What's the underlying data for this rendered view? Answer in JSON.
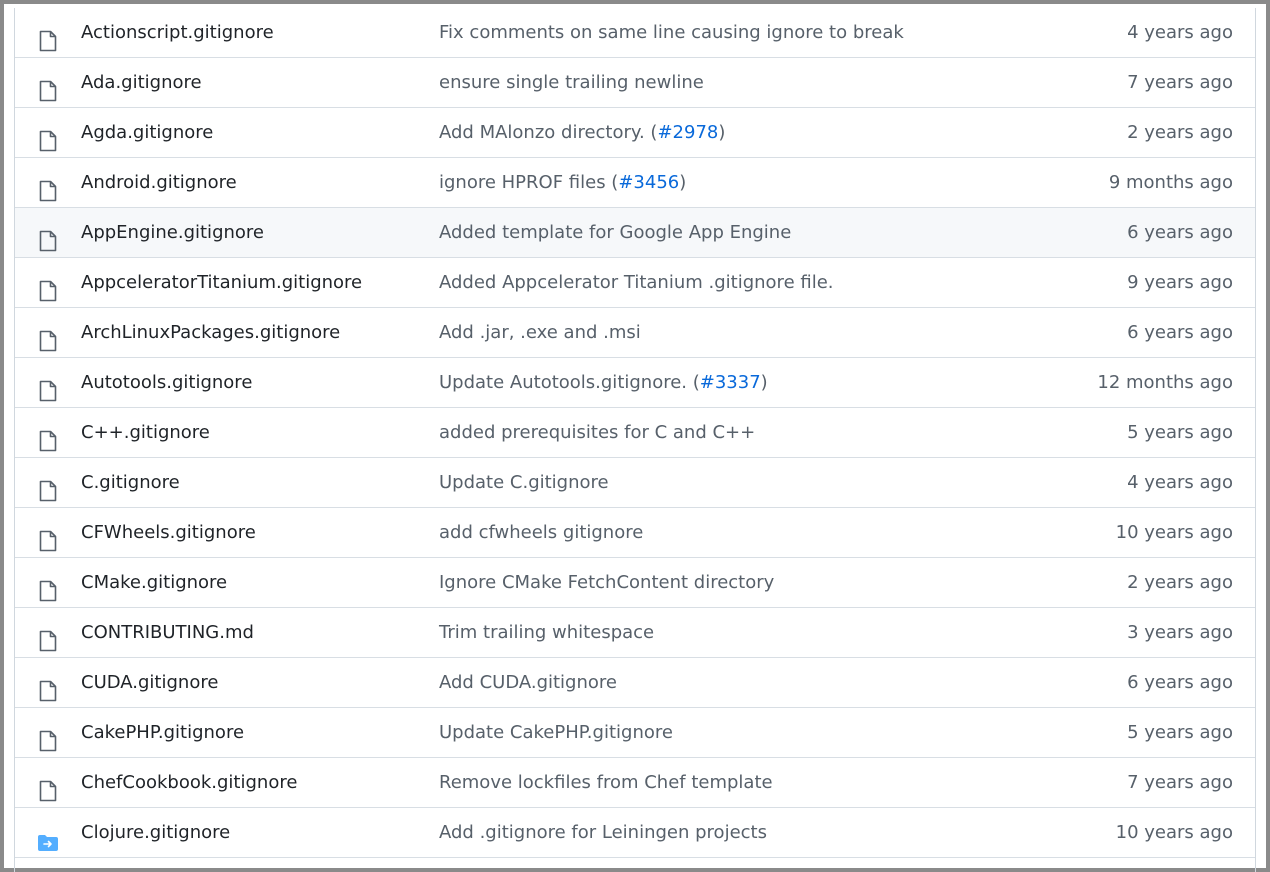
{
  "colors": {
    "link": "#0969da",
    "muted": "#57606a",
    "text": "#1f2328",
    "folder": "#54aeff",
    "border": "#d8dee4",
    "hover_bg": "#f6f8fa"
  },
  "files": [
    {
      "icon": "file-icon",
      "name": "Actionscript.gitignore",
      "message": "Fix comments on same line causing ignore to break",
      "issue": "",
      "age": "4 years ago"
    },
    {
      "icon": "file-icon",
      "name": "Ada.gitignore",
      "message": "ensure single trailing newline",
      "issue": "",
      "age": "7 years ago"
    },
    {
      "icon": "file-icon",
      "name": "Agda.gitignore",
      "message": "Add MAlonzo directory. (",
      "issue": "#2978",
      "age": "2 years ago"
    },
    {
      "icon": "file-icon",
      "name": "Android.gitignore",
      "message": "ignore HPROF files (",
      "issue": "#3456",
      "age": "9 months ago"
    },
    {
      "icon": "file-icon",
      "name": "AppEngine.gitignore",
      "message": "Added template for Google App Engine",
      "issue": "",
      "age": "6 years ago",
      "hover": true
    },
    {
      "icon": "file-icon",
      "name": "AppceleratorTitanium.gitignore",
      "message": "Added Appcelerator Titanium .gitignore file.",
      "issue": "",
      "age": "9 years ago"
    },
    {
      "icon": "file-icon",
      "name": "ArchLinuxPackages.gitignore",
      "message": "Add .jar, .exe and .msi",
      "issue": "",
      "age": "6 years ago"
    },
    {
      "icon": "file-icon",
      "name": "Autotools.gitignore",
      "message": "Update Autotools.gitignore. (",
      "issue": "#3337",
      "age": "12 months ago"
    },
    {
      "icon": "file-icon",
      "name": "C++.gitignore",
      "message": "added prerequisites for C and C++",
      "issue": "",
      "age": "5 years ago"
    },
    {
      "icon": "file-icon",
      "name": "C.gitignore",
      "message": "Update C.gitignore",
      "issue": "",
      "age": "4 years ago"
    },
    {
      "icon": "file-icon",
      "name": "CFWheels.gitignore",
      "message": "add cfwheels gitignore",
      "issue": "",
      "age": "10 years ago"
    },
    {
      "icon": "file-icon",
      "name": "CMake.gitignore",
      "message": "Ignore CMake FetchContent directory",
      "issue": "",
      "age": "2 years ago"
    },
    {
      "icon": "file-icon",
      "name": "CONTRIBUTING.md",
      "message": "Trim trailing whitespace",
      "issue": "",
      "age": "3 years ago"
    },
    {
      "icon": "file-icon",
      "name": "CUDA.gitignore",
      "message": "Add CUDA.gitignore",
      "issue": "",
      "age": "6 years ago"
    },
    {
      "icon": "file-icon",
      "name": "CakePHP.gitignore",
      "message": "Update CakePHP.gitignore",
      "issue": "",
      "age": "5 years ago"
    },
    {
      "icon": "file-icon",
      "name": "ChefCookbook.gitignore",
      "message": "Remove lockfiles from Chef template",
      "issue": "",
      "age": "7 years ago"
    },
    {
      "icon": "symlink-folder-icon",
      "name": "Clojure.gitignore",
      "message": "Add .gitignore for Leiningen projects",
      "issue": "",
      "age": "10 years ago"
    }
  ]
}
